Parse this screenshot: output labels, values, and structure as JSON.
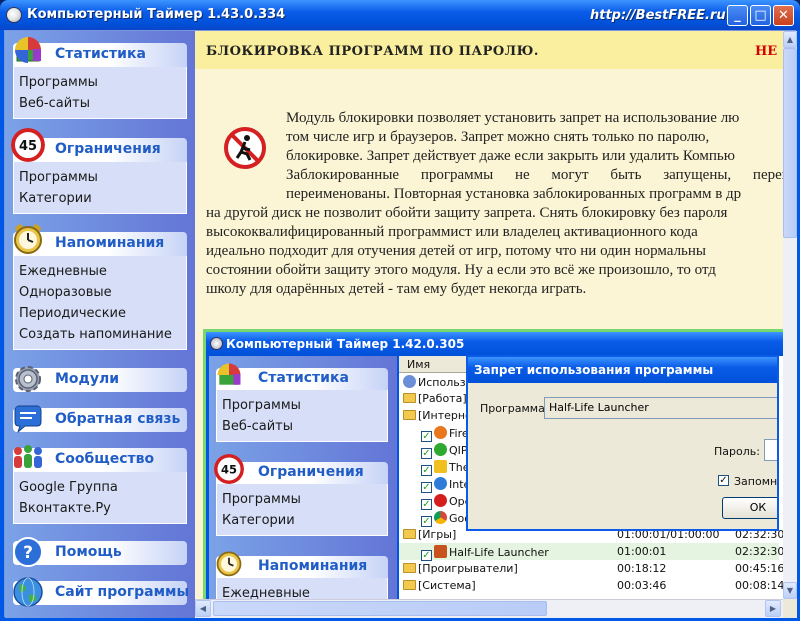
{
  "window": {
    "title": "Компьютерный Таймер 1.43.0.334",
    "brand": "http://BestFREE.ru"
  },
  "sidebar": {
    "groups": [
      {
        "title": "Статистика",
        "icon": "pie-chart-icon",
        "items": [
          "Программы",
          "Веб-сайты"
        ]
      },
      {
        "title": "Ограничения",
        "icon": "speed-limit-45-icon",
        "badge": "45",
        "items": [
          "Программы",
          "Категории"
        ]
      },
      {
        "title": "Напоминания",
        "icon": "alarm-clock-icon",
        "items": [
          "Ежедневные",
          "Одноразовые",
          "Периодические",
          "Создать напоминание"
        ]
      },
      {
        "title": "Модули",
        "icon": "gear-icon",
        "items": []
      },
      {
        "title": "Обратная связь",
        "icon": "chat-bubble-icon",
        "items": []
      },
      {
        "title": "Сообщество",
        "icon": "people-icon",
        "items": [
          "Google Группа",
          "Вконтакте.Ру"
        ]
      },
      {
        "title": "Помощь",
        "icon": "help-question-icon",
        "badge": "?",
        "items": []
      },
      {
        "title": "Сайт программы",
        "icon": "globe-icon",
        "items": []
      }
    ]
  },
  "main": {
    "header_title": "БЛОКИРОВКА ПРОГРАММ ПО ПАРОЛЮ.",
    "header_warning": "НЕ",
    "paragraph_lines": [
      "Модуль блокировки позволяет установить запрет на использование лю",
      "том числе игр и браузеров. Запрет можно снять только по паролю,",
      "блокировке. Запрет действует даже если закрыть или удалить Компью",
      "Заблокированные программы не могут быть запущены, переименованы. Повторная установка заблокированных программ в др",
      "переименованы. Повторная установка заблокированных программ в др",
      "на другой диск не позволит обойти защиту запрета. Снять блокировку без пароля",
      "высококвалифицированный программист или владелец активационного кода",
      "идеально подходит для отучения детей от игр, потому что ни один нормальны",
      "состоянии обойти защиту этого модуля. Ну а если это всё же произошло, то отд",
      "школу для одарённых детей - там ему будет некогда играть."
    ]
  },
  "embedded": {
    "title": "Компьютерный Таймер 1.42.0.305",
    "sidebar_groups": [
      {
        "title": "Статистика",
        "items": [
          "Программы",
          "Веб-сайты"
        ]
      },
      {
        "title": "Ограничения",
        "badge": "45",
        "items": [
          "Программы",
          "Категории"
        ]
      },
      {
        "title": "Напоминания",
        "items": [
          "Ежедневные"
        ]
      }
    ],
    "list_header": "Имя",
    "rows": [
      {
        "name": "Использо",
        "t1": "",
        "t2": ""
      },
      {
        "name": "[Работа]",
        "t1": "",
        "t2": ""
      },
      {
        "name": "[Интерне",
        "t1": "",
        "t2": ""
      },
      {
        "name": "Fire",
        "t1": "",
        "t2": ""
      },
      {
        "name": "QIP",
        "t1": "",
        "t2": ""
      },
      {
        "name": "The",
        "t1": "",
        "t2": ""
      },
      {
        "name": "Inte",
        "t1": "",
        "t2": ""
      },
      {
        "name": "Ope",
        "t1": "",
        "t2": ""
      },
      {
        "name": "Goo",
        "t1": "",
        "t2": ""
      },
      {
        "name": "[Игры]",
        "t1": "01:00:01/01:00:00",
        "t2": "02:32:30"
      },
      {
        "name": "Half-Life Launcher",
        "t1": "01:00:01",
        "t2": "02:32:30"
      },
      {
        "name": "[Проигрыватели]",
        "t1": "00:18:12",
        "t2": "00:45:16"
      },
      {
        "name": "[Система]",
        "t1": "00:03:46",
        "t2": "00:08:14"
      }
    ],
    "dialog": {
      "title": "Запрет использования программы",
      "program_label": "Программа:",
      "program_value": "Half-Life Launcher",
      "password_label": "Пароль:",
      "remember_label": "Запомни",
      "ok_label": "ОК"
    }
  },
  "colors": {
    "title_blue": "#0058E6",
    "sidebar_text": "#215DC6",
    "header_band": "#F9EF9E",
    "content_bg": "#FBF5D5",
    "warning": "#D40000"
  }
}
